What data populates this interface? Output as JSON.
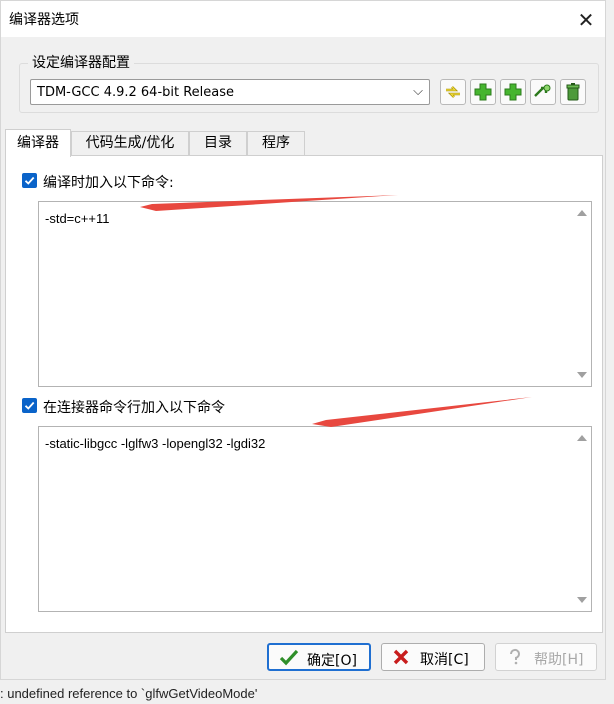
{
  "window": {
    "title": "编译器选项"
  },
  "compiler_set": {
    "group_title": "设定编译器配置",
    "selected": "TDM-GCC 4.9.2 64-bit Release",
    "toolbar_icons": [
      "rename-icon",
      "add-icon",
      "add-folder-icon",
      "find-icon",
      "delete-icon"
    ]
  },
  "tabs": [
    {
      "label": "编译器"
    },
    {
      "label": "代码生成/优化"
    },
    {
      "label": "目录"
    },
    {
      "label": "程序"
    }
  ],
  "compiler_panel": {
    "compile_check_label": "编译时加入以下命令:",
    "compile_args": "-std=c++11",
    "linker_check_label": "在连接器命令行加入以下命令",
    "linker_args": "-static-libgcc -lglfw3 -lopengl32 -lgdi32"
  },
  "buttons": {
    "ok": "确定[O]",
    "cancel": "取消[C]",
    "help": "帮助[H]"
  },
  "background_text": ": undefined reference to `glfwGetVideoMode'",
  "colors": {
    "annotation_arrow": "#e8483f",
    "checkbox": "#0a63c9"
  }
}
